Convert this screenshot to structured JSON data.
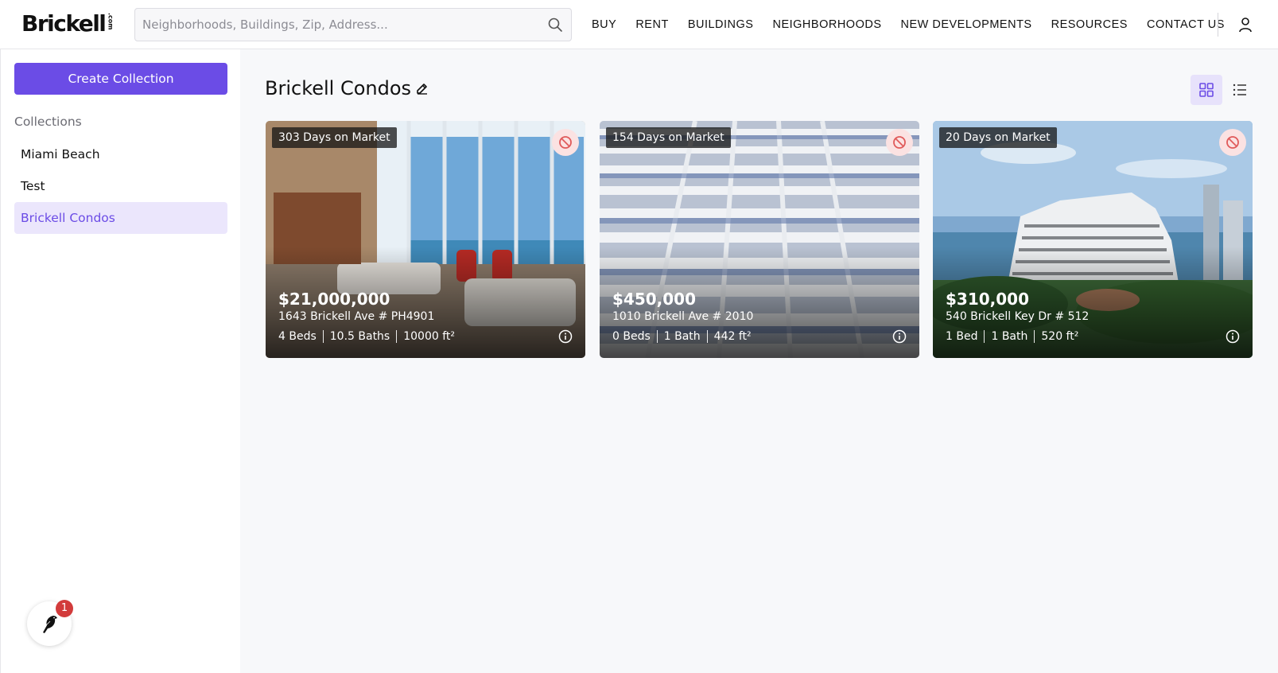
{
  "header": {
    "logo_text": "Brickell",
    "logo_suffix": ".com",
    "search_placeholder": "Neighborhoods, Buildings, Zip, Address...",
    "nav": [
      "BUY",
      "RENT",
      "BUILDINGS",
      "NEIGHBORHOODS",
      "NEW DEVELOPMENTS",
      "RESOURCES",
      "CONTACT US"
    ]
  },
  "sidebar": {
    "create_label": "Create Collection",
    "collections_label": "Collections",
    "collections": [
      "Miami Beach",
      "Test",
      "Brickell Condos"
    ],
    "active_collection": "Brickell Condos",
    "chat_badge": "1"
  },
  "main": {
    "title": "Brickell Condos",
    "listings": [
      {
        "days": "303 Days on Market",
        "price": "$21,000,000",
        "address": "1643 Brickell Ave # PH4901",
        "beds": "4 Beds",
        "baths": "10.5 Baths",
        "area": "10000 ft²"
      },
      {
        "days": "154 Days on Market",
        "price": "$450,000",
        "address": "1010 Brickell Ave # 2010",
        "beds": "0 Beds",
        "baths": "1 Bath",
        "area": "442 ft²"
      },
      {
        "days": "20 Days on Market",
        "price": "$310,000",
        "address": "540 Brickell Key Dr # 512",
        "beds": "1 Bed",
        "baths": "1 Bath",
        "area": "520 ft²"
      }
    ]
  },
  "colors": {
    "accent": "#6b4ce6",
    "accent_light": "#ebe6fc",
    "hide_red": "#e05a5a"
  },
  "icons": [
    "search-icon",
    "user-icon",
    "edit-icon",
    "grid-view-icon",
    "list-view-icon",
    "hide-icon",
    "info-icon",
    "bird-icon"
  ]
}
